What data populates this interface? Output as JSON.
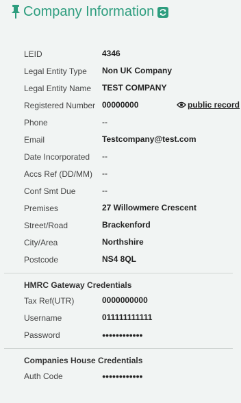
{
  "header": {
    "title": "Company Information"
  },
  "company": [
    {
      "label": "LEID",
      "value": "4346"
    },
    {
      "label": "Legal Entity Type",
      "value": "Non UK Company"
    },
    {
      "label": "Legal Entity Name",
      "value": "TEST COMPANY"
    },
    {
      "label": "Registered Number",
      "value": "00000000"
    },
    {
      "label": "Phone",
      "value": "--"
    },
    {
      "label": "Email",
      "value": "Testcompany@test.com"
    },
    {
      "label": "Date Incorporated",
      "value": "--"
    },
    {
      "label": "Accs Ref (DD/MM)",
      "value": "--"
    },
    {
      "label": "Conf Smt Due",
      "value": "--"
    },
    {
      "label": "Premises",
      "value": "27 Willowmere Crescent"
    },
    {
      "label": "Street/Road",
      "value": "Brackenford"
    },
    {
      "label": "City/Area",
      "value": "Northshire"
    },
    {
      "label": "Postcode",
      "value": "NS4 8QL"
    }
  ],
  "public_record_link": "public record",
  "hmrc": {
    "heading": "HMRC Gateway Credentials",
    "rows": [
      {
        "label": "Tax Ref(UTR)",
        "value": "0000000000"
      },
      {
        "label": "Username",
        "value": "011111111111"
      },
      {
        "label": "Password",
        "value": "●●●●●●●●●●●●"
      }
    ]
  },
  "companies_house": {
    "heading": "Companies House Credentials",
    "rows": [
      {
        "label": "Auth Code",
        "value": "●●●●●●●●●●●●"
      }
    ]
  },
  "colors": {
    "accent": "#2d9d7e",
    "background": "#f1f4f3"
  },
  "icons": {
    "pin": "pin-icon",
    "refresh": "refresh-icon",
    "eye": "eye-icon"
  }
}
